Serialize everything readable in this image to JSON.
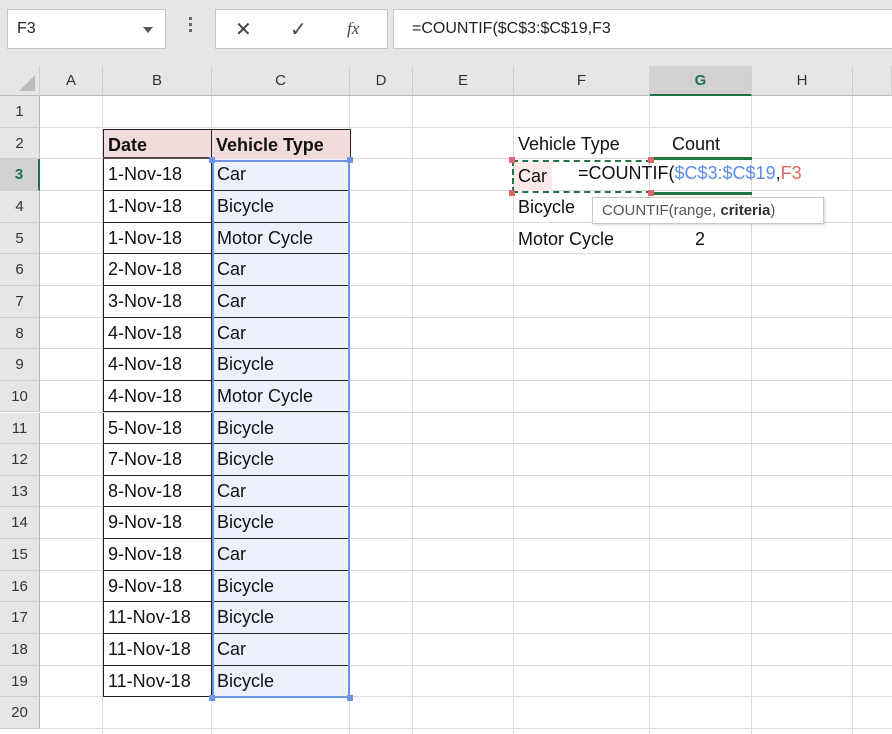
{
  "name_box": {
    "value": "F3"
  },
  "formula_bar": {
    "cancel_icon": "close-icon",
    "enter_icon": "checkmark-icon",
    "function_icon": "fx-icon",
    "cancel_glyph": "✕",
    "enter_glyph": "✓",
    "function_glyph": "fx",
    "formula": "=COUNTIF($C$3:$C$19,F3"
  },
  "columns": [
    "A",
    "B",
    "C",
    "D",
    "E",
    "F",
    "G",
    "H"
  ],
  "selected_column": "G",
  "rows": [
    "1",
    "2",
    "3",
    "4",
    "5",
    "6",
    "7",
    "8",
    "9",
    "10",
    "11",
    "12",
    "13",
    "14",
    "15",
    "16",
    "17",
    "18",
    "19",
    "20"
  ],
  "selected_row": "3",
  "source_table": {
    "headers": {
      "date": "Date",
      "vehicle_type": "Vehicle Type"
    },
    "records": [
      {
        "date": "1-Nov-18",
        "type": "Car"
      },
      {
        "date": "1-Nov-18",
        "type": "Bicycle"
      },
      {
        "date": "1-Nov-18",
        "type": "Motor Cycle"
      },
      {
        "date": "2-Nov-18",
        "type": "Car"
      },
      {
        "date": "3-Nov-18",
        "type": "Car"
      },
      {
        "date": "4-Nov-18",
        "type": "Car"
      },
      {
        "date": "4-Nov-18",
        "type": "Bicycle"
      },
      {
        "date": "4-Nov-18",
        "type": "Motor Cycle"
      },
      {
        "date": "5-Nov-18",
        "type": "Bicycle"
      },
      {
        "date": "7-Nov-18",
        "type": "Bicycle"
      },
      {
        "date": "8-Nov-18",
        "type": "Car"
      },
      {
        "date": "9-Nov-18",
        "type": "Bicycle"
      },
      {
        "date": "9-Nov-18",
        "type": "Car"
      },
      {
        "date": "9-Nov-18",
        "type": "Bicycle"
      },
      {
        "date": "11-Nov-18",
        "type": "Bicycle"
      },
      {
        "date": "11-Nov-18",
        "type": "Car"
      },
      {
        "date": "11-Nov-18",
        "type": "Bicycle"
      }
    ]
  },
  "summary_table": {
    "headers": {
      "vehicle_type": "Vehicle Type",
      "count": "Count"
    },
    "rows": [
      {
        "type": "Car",
        "count": ""
      },
      {
        "type": "Bicycle",
        "count": ""
      },
      {
        "type": "Motor Cycle",
        "count": "2"
      }
    ]
  },
  "cell_editor": {
    "prefix": "=COUNTIF(",
    "range_ref": "$C$3:$C$19",
    "separator": ",",
    "criteria_ref": "F3",
    "range_color": "#5b8ee6",
    "criteria_color": "#e06666"
  },
  "tooltip": {
    "fn": "COUNTIF(range, ",
    "bold_arg": "criteria",
    "close": ")"
  },
  "colors": {
    "excel_green": "#217346",
    "header_fill": "#f2dcdb",
    "range_fill": "#eef1fb"
  }
}
